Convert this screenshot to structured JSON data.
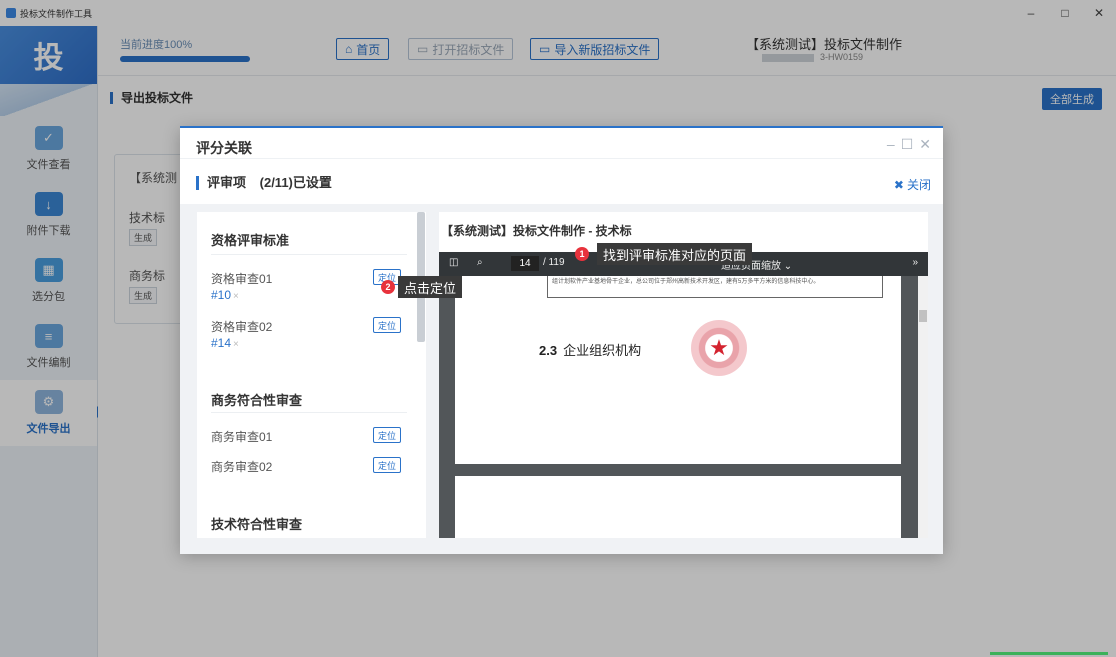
{
  "window": {
    "title": "投标文件制作工具",
    "controls": [
      "–",
      "□",
      "✕"
    ]
  },
  "sidebar": {
    "logo": "投",
    "items": [
      {
        "label": "文件查看",
        "icon": "document-check-icon",
        "color": "#6aa7de"
      },
      {
        "label": "附件下载",
        "icon": "download-box-icon",
        "color": "#3b87d4"
      },
      {
        "label": "选分包",
        "icon": "package-grid-icon",
        "color": "#4a9ee0"
      },
      {
        "label": "文件编制",
        "icon": "edit-document-icon",
        "color": "#6aa7de"
      },
      {
        "label": "文件导出",
        "icon": "export-gear-icon",
        "color": "#f0a030"
      }
    ],
    "active_index": 4
  },
  "header": {
    "progress_label": "当前进度100%",
    "progress_value": 1.0,
    "home_button": "首页",
    "open_button": "打开招标文件",
    "import_button": "导入新版招标文件",
    "project_title": "【系统测试】投标文件制作",
    "project_code": "3-HW0159"
  },
  "main": {
    "section_title": "导出投标文件",
    "generate_all_button": "全部生成",
    "card": {
      "title": "【系统测",
      "tech_label": "技术标",
      "tech_action": "生成",
      "biz_label": "商务标",
      "biz_action": "生成"
    }
  },
  "modal": {
    "title": "评分关联",
    "subtitle": "评审项",
    "status": "(2/11)已设置",
    "close_label": "关闭",
    "groups": [
      {
        "title": "资格评审标准",
        "items": [
          {
            "name": "资格审查01",
            "ref": "#10",
            "locate": "定位"
          },
          {
            "name": "资格审查02",
            "ref": "#14",
            "locate": "定位"
          }
        ]
      },
      {
        "title": "商务符合性审查",
        "items": [
          {
            "name": "商务审查01",
            "ref": "",
            "locate": "定位"
          },
          {
            "name": "商务审查02",
            "ref": "",
            "locate": "定位"
          }
        ]
      },
      {
        "title": "技术符合性审查",
        "items": []
      }
    ],
    "viewer": {
      "title": "【系统测试】投标文件制作 - 技术标",
      "current_page": "14",
      "total_pages": "/ 119",
      "zoom_label": "适应页面缩放",
      "boxed_text": "组计划软件产业基地骨干企业，总公司位于郑州高新技术开发区，建有5万多平方米的信息科技中心。",
      "heading_number": "2.3",
      "heading_text": "企业组织机构"
    }
  },
  "annotations": {
    "step1_num": "1",
    "step1_text": "找到评审标准对应的页面",
    "step2_num": "2",
    "step2_text": "点击定位"
  },
  "colors": {
    "accent": "#2a72c9",
    "badge": "#e8323c",
    "progress_done": "#3cb15a"
  }
}
